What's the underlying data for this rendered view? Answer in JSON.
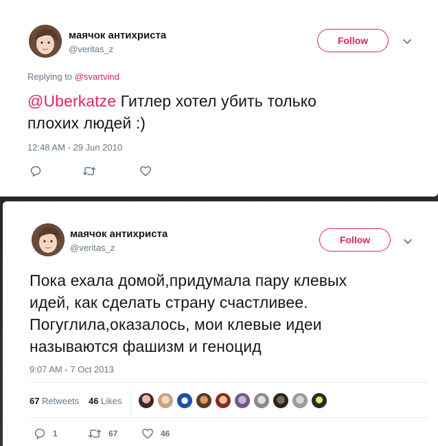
{
  "tweet1": {
    "user": {
      "name": "маячок антихриста",
      "handle": "@veritas_z"
    },
    "follow_label": "Follow",
    "replying_prefix": "Replying to",
    "replying_to": "@svartvind",
    "mention": "@Uberkatze",
    "text_line1": " Гитлер хотел убить только",
    "text_line2": "плохих людей :)",
    "timestamp": "12:48 AM - 29 Jun 2010"
  },
  "tweet2": {
    "user": {
      "name": "маячок антихриста",
      "handle": "@veritas_z"
    },
    "follow_label": "Follow",
    "text_lines": [
      "Пока ехала домой,придумала пару клевых",
      "идей, как сделать страну счастливее.",
      "Погуглила,оказалось, мои клевые идеи",
      "называются фашизм и геноцид"
    ],
    "timestamp": "9:07 AM - 7 Oct 2013",
    "stats": {
      "retweets_count": "67",
      "retweets_label": "Retweets",
      "likes_count": "46",
      "likes_label": "Likes"
    },
    "actions": {
      "replies": "1",
      "retweets": "67",
      "likes": "46"
    }
  },
  "colors": {
    "accent": "#e0245e",
    "text": "#14171a",
    "muted": "#657786",
    "divider": "#e6ecf0"
  },
  "icons": [
    "chevron-down-icon",
    "reply-icon",
    "retweet-icon",
    "like-icon"
  ]
}
